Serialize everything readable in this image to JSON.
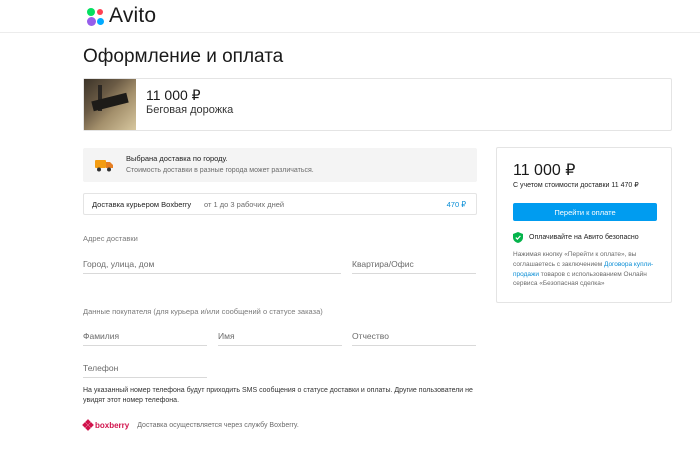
{
  "header": {
    "logo_text": "Avito"
  },
  "page_title": "Оформление и оплата",
  "product": {
    "price": "11 000 ₽",
    "name": "Беговая дорожка"
  },
  "delivery": {
    "title": "Выбрана доставка по городу.",
    "subtitle": "Стоимость доставки в разные города может различаться.",
    "courier_name": "Доставка курьером Boxberry",
    "courier_days": "от 1 до 3 рабочих дней",
    "courier_price": "470 ₽"
  },
  "address": {
    "label": "Адрес доставки",
    "street_placeholder": "Город, улица, дом",
    "apartment_placeholder": "Квартира/Офис"
  },
  "buyer": {
    "label": "Данные покупателя (для курьера и/или сообщений о статусе заказа)",
    "last_name_placeholder": "Фамилия",
    "first_name_placeholder": "Имя",
    "middle_name_placeholder": "Отчество",
    "phone_placeholder": "Телефон"
  },
  "phone_note": "На указанный номер телефона будут приходить SMS сообщения о статусе доставки и оплаты. Другие пользователи не увидят этот номер телефона.",
  "boxberry": {
    "brand": "boxberry",
    "note": "Доставка осуществляется через службу Boxberry."
  },
  "summary": {
    "price": "11 000 ₽",
    "with_delivery": "С учетом стоимости доставки 11 470 ₽",
    "pay_button": "Перейти к оплате",
    "safe_text": "Оплачивайте на Авито безопасно",
    "terms_before": "Нажимая кнопку «Перейти к оплате», вы соглашаетесь с заключением ",
    "terms_link": "Договора купли-продажи",
    "terms_after": " товаров с использованием Онлайн сервиса «Безопасная сделка»"
  },
  "colors": {
    "accent": "#009cf0",
    "link": "#0a8ed6",
    "safe_green": "#04b34b",
    "boxberry": "#d1134c",
    "truck_orange": "#f39c12"
  }
}
